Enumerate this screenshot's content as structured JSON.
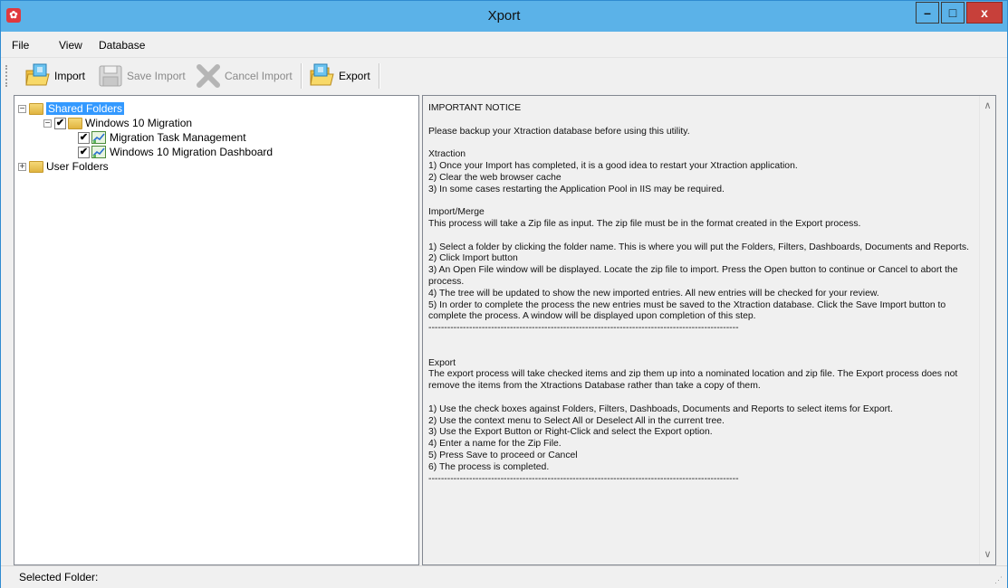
{
  "window": {
    "title": "Xport",
    "min_glyph": "–",
    "max_glyph": "□",
    "close_glyph": "x"
  },
  "menu": {
    "items": [
      "File",
      "View",
      "Database"
    ]
  },
  "toolbar": {
    "import": "Import",
    "save_import": "Save Import",
    "cancel_import": "Cancel Import",
    "export": "Export"
  },
  "tree": {
    "shared_folders": "Shared Folders",
    "win10_migration": "Windows 10 Migration",
    "task_management": "Migration Task Management",
    "dashboard": "Windows 10 Migration Dashboard",
    "user_folders": "User Folders",
    "expanded_glyph": "−",
    "collapsed_glyph": "+",
    "check_glyph": "✔"
  },
  "notice": {
    "text": "IMPORTANT NOTICE\n\nPlease backup your Xtraction database before using this utility.\n\nXtraction\n1) Once your Import has completed, it is a good idea to restart your Xtraction application.\n2) Clear the web browser cache\n3) In some cases restarting the Application Pool in IIS may be required.\n\nImport/Merge\nThis process will take a Zip file as input. The zip file must be in the format created in the Export process.\n\n1) Select a folder by clicking the folder name. This is where you will put the Folders, Filters, Dashboards, Documents and Reports.\n2) Click Import button\n3) An Open File window will be displayed. Locate the zip file to import. Press the Open button to continue or Cancel to abort the process.\n4) The tree will be updated to show the new imported entries. All new entries will be checked for your review.\n5) In order to complete the process the new entries must be saved to the Xtraction database. Click the Save Import button to complete the process. A window will be displayed upon completion of this step.\n---------------------------------------------------------------------------------------------------\n\n\nExport\nThe export process will take checked items and zip them up into a nominated location and zip file. The Export process does not remove the items from the Xtractions Database rather than take a copy of them.\n\n1) Use the check boxes against Folders, Filters, Dashboads, Documents and Reports to select items for Export.\n2) Use the context menu to Select All or Deselect All in the current tree.\n3) Use the Export Button or Right-Click and select the Export option.\n4) Enter a name for the Zip File.\n5) Press Save to proceed or Cancel\n6) The process is completed.\n---------------------------------------------------------------------------------------------------",
    "scroll_up": "∧",
    "scroll_down": "∨"
  },
  "status": {
    "label": "Selected Folder:",
    "grip": "⋰"
  },
  "colors": {
    "titlebar": "#5bb2e8",
    "selection": "#3399ff",
    "close": "#c7403a"
  },
  "icons": {
    "app": "app-logo-icon",
    "import": "import-folder-icon",
    "save": "save-disk-icon",
    "cancel": "cancel-x-icon",
    "export": "export-folder-icon",
    "folder": "folder-icon",
    "dashboard": "chart-icon"
  }
}
